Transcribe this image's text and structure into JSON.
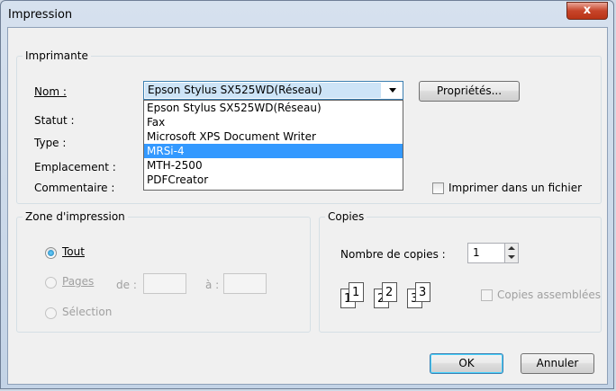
{
  "window": {
    "title": "Impression",
    "close_glyph": "x"
  },
  "printer": {
    "group_label": "Imprimante",
    "name_label": "Nom :",
    "status_label": "Statut :",
    "type_label": "Type :",
    "location_label": "Emplacement :",
    "comment_label": "Commentaire :",
    "selected": "Epson Stylus SX525WD(Réseau)",
    "properties_button": "Propriétés...",
    "print_to_file_label": "Imprimer dans un fichier",
    "options": [
      "Epson Stylus SX525WD(Réseau)",
      "Fax",
      "Microsoft XPS Document Writer",
      "MRSi-4",
      "MTH-2500",
      "PDFCreator"
    ],
    "highlighted_option": "MRSi-4"
  },
  "range": {
    "group_label": "Zone d'impression",
    "all_label": "Tout",
    "pages_label": "Pages",
    "from_label": "de :",
    "to_label": "à :",
    "selection_label": "Sélection"
  },
  "copies": {
    "group_label": "Copies",
    "count_label": "Nombre de copies :",
    "count_value": "1",
    "collate_label": "Copies assemblées",
    "collate_icon_digits": [
      "1",
      "1",
      "2",
      "2",
      "3",
      "3"
    ]
  },
  "buttons": {
    "ok": "OK",
    "cancel": "Annuler"
  }
}
